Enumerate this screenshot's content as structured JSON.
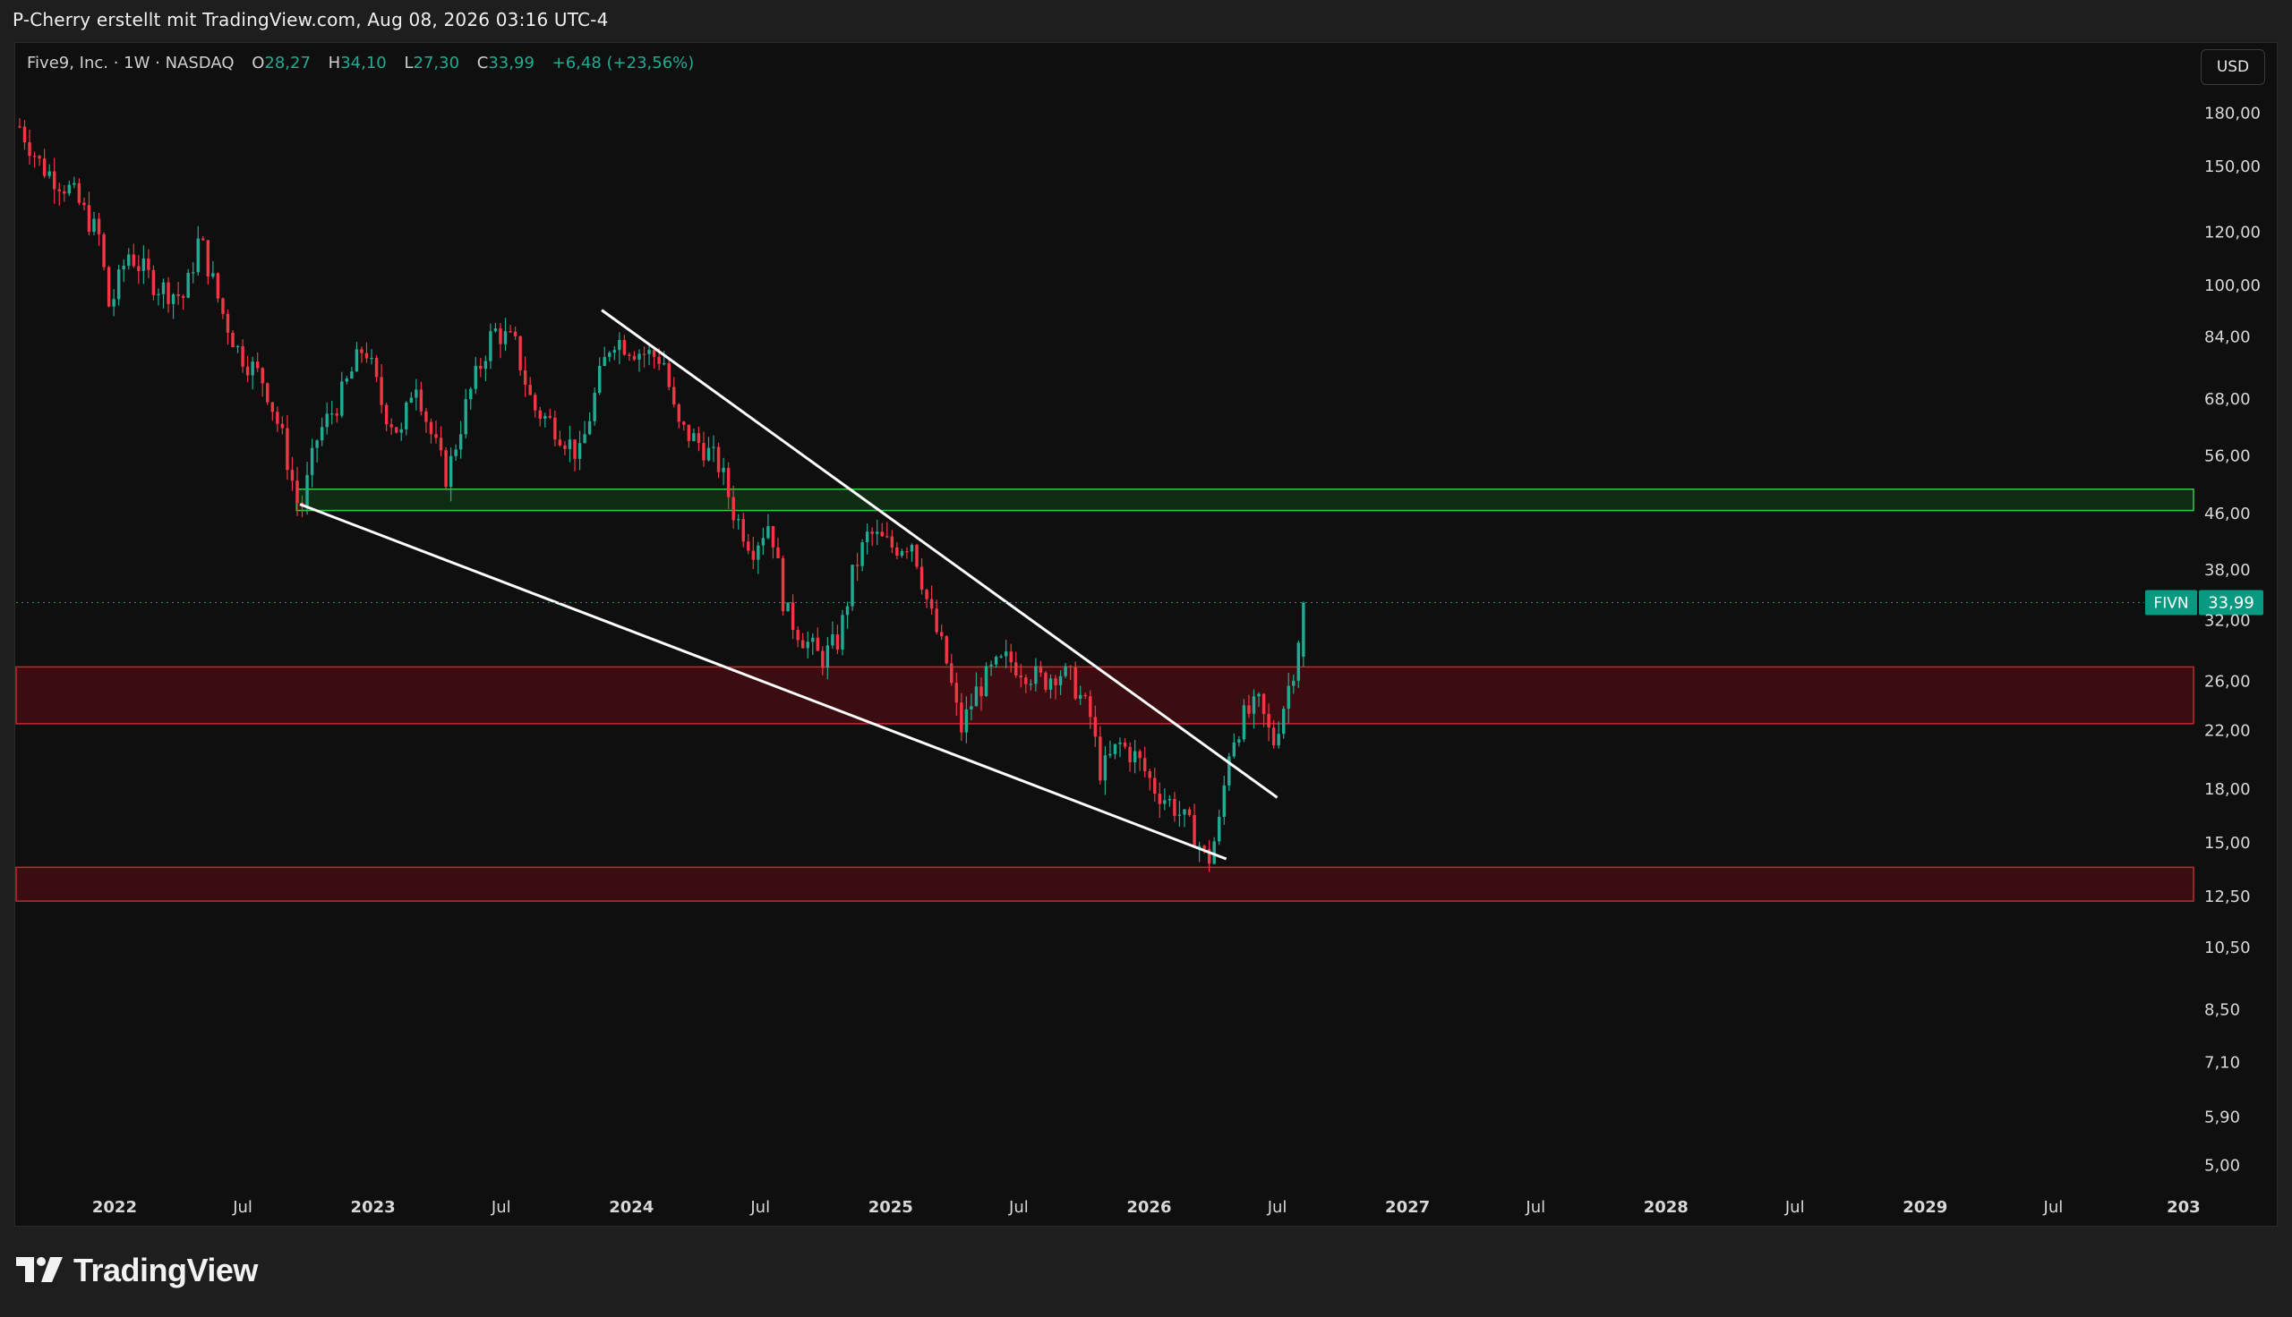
{
  "header": {
    "author_line": "P-Cherry erstellt mit TradingView.com, Aug 08, 2026 03:16 UTC-4"
  },
  "legend": {
    "symbol_line": "Five9, Inc. · 1W · NASDAQ",
    "o_label": "O",
    "o_value": "28,27",
    "h_label": "H",
    "h_value": "34,10",
    "l_label": "L",
    "l_value": "27,30",
    "c_label": "C",
    "c_value": "33,99",
    "change": "+6,48 (+23,56%)"
  },
  "currency_button": "USD",
  "brand": {
    "name": "TradingView"
  },
  "colors": {
    "up": "#22ab94",
    "down": "#f23645",
    "support_zone_fill": "#3b0d10",
    "support_zone_border": "#c62833",
    "resistance_zone_fill": "#0f2d12",
    "resistance_zone_border": "#2ecc40",
    "trendline": "#ffffff",
    "price_badge": "#089981"
  },
  "chart_data": {
    "type": "candlestick",
    "timeframe": "1W",
    "y_scale": "log",
    "ylim": [
      4.6,
      195
    ],
    "xlim": [
      "2021-08-15",
      "2030-01-15"
    ],
    "y_ticks": [
      {
        "value": 180,
        "label": "180,00"
      },
      {
        "value": 150,
        "label": "150,00"
      },
      {
        "value": 120,
        "label": "120,00"
      },
      {
        "value": 100,
        "label": "100,00"
      },
      {
        "value": 84,
        "label": "84,00"
      },
      {
        "value": 68,
        "label": "68,00"
      },
      {
        "value": 56,
        "label": "56,00"
      },
      {
        "value": 46,
        "label": "46,00"
      },
      {
        "value": 38,
        "label": "38,00"
      },
      {
        "value": 32,
        "label": "32,00"
      },
      {
        "value": 26,
        "label": "26,00"
      },
      {
        "value": 22,
        "label": "22,00"
      },
      {
        "value": 18,
        "label": "18,00"
      },
      {
        "value": 15,
        "label": "15,00"
      },
      {
        "value": 12.5,
        "label": "12,50"
      },
      {
        "value": 10.5,
        "label": "10,50"
      },
      {
        "value": 8.5,
        "label": "8,50"
      },
      {
        "value": 7.1,
        "label": "7,10"
      },
      {
        "value": 5.9,
        "label": "5,90"
      },
      {
        "value": 5.0,
        "label": "5,00"
      }
    ],
    "x_ticks": [
      {
        "date": "2022-01-01",
        "label": "2022",
        "major": true
      },
      {
        "date": "2022-07-01",
        "label": "Jul",
        "major": false
      },
      {
        "date": "2023-01-01",
        "label": "2023",
        "major": true
      },
      {
        "date": "2023-07-01",
        "label": "Jul",
        "major": false
      },
      {
        "date": "2024-01-01",
        "label": "2024",
        "major": true
      },
      {
        "date": "2024-07-01",
        "label": "Jul",
        "major": false
      },
      {
        "date": "2025-01-01",
        "label": "2025",
        "major": true
      },
      {
        "date": "2025-07-01",
        "label": "Jul",
        "major": false
      },
      {
        "date": "2026-01-01",
        "label": "2026",
        "major": true
      },
      {
        "date": "2026-07-01",
        "label": "Jul",
        "major": false
      },
      {
        "date": "2027-01-01",
        "label": "2027",
        "major": true
      },
      {
        "date": "2027-07-01",
        "label": "Jul",
        "major": false
      },
      {
        "date": "2028-01-01",
        "label": "2028",
        "major": true
      },
      {
        "date": "2028-07-01",
        "label": "Jul",
        "major": false
      },
      {
        "date": "2029-01-01",
        "label": "2029",
        "major": true
      },
      {
        "date": "2029-07-01",
        "label": "Jul",
        "major": false
      },
      {
        "date": "2030-01-01",
        "label": "203",
        "major": true
      }
    ],
    "price_anchors": [
      [
        "2021-08-20",
        172
      ],
      [
        "2021-09-20",
        150
      ],
      [
        "2021-11-01",
        138
      ],
      [
        "2021-12-10",
        118
      ],
      [
        "2021-12-25",
        92
      ],
      [
        "2022-01-20",
        112
      ],
      [
        "2022-03-01",
        100
      ],
      [
        "2022-04-10",
        96
      ],
      [
        "2022-05-01",
        118
      ],
      [
        "2022-06-01",
        92
      ],
      [
        "2022-06-25",
        80
      ],
      [
        "2022-08-01",
        72
      ],
      [
        "2022-08-25",
        60
      ],
      [
        "2022-09-20",
        46
      ],
      [
        "2022-10-15",
        60
      ],
      [
        "2022-11-15",
        68
      ],
      [
        "2022-12-20",
        82
      ],
      [
        "2023-01-15",
        66
      ],
      [
        "2023-02-10",
        60
      ],
      [
        "2023-03-01",
        74
      ],
      [
        "2023-03-20",
        62
      ],
      [
        "2023-04-15",
        52
      ],
      [
        "2023-05-15",
        68
      ],
      [
        "2023-06-20",
        86
      ],
      [
        "2023-07-20",
        82
      ],
      [
        "2023-08-15",
        66
      ],
      [
        "2023-09-15",
        62
      ],
      [
        "2023-10-20",
        56
      ],
      [
        "2023-11-15",
        72
      ],
      [
        "2023-12-05",
        84
      ],
      [
        "2024-01-10",
        80
      ],
      [
        "2024-02-15",
        78
      ],
      [
        "2024-03-05",
        62
      ],
      [
        "2024-04-10",
        58
      ],
      [
        "2024-05-05",
        54
      ],
      [
        "2024-05-25",
        46
      ],
      [
        "2024-06-20",
        41
      ],
      [
        "2024-07-15",
        45
      ],
      [
        "2024-08-05",
        33
      ],
      [
        "2024-09-01",
        30
      ],
      [
        "2024-09-25",
        28
      ],
      [
        "2024-10-20",
        30
      ],
      [
        "2024-11-10",
        38
      ],
      [
        "2024-12-01",
        43
      ],
      [
        "2025-01-05",
        41
      ],
      [
        "2025-02-01",
        42
      ],
      [
        "2025-02-25",
        33
      ],
      [
        "2025-03-20",
        28
      ],
      [
        "2025-04-10",
        22
      ],
      [
        "2025-05-01",
        25
      ],
      [
        "2025-05-25",
        27
      ],
      [
        "2025-06-15",
        28
      ],
      [
        "2025-07-10",
        27
      ],
      [
        "2025-08-05",
        26
      ],
      [
        "2025-08-25",
        27
      ],
      [
        "2025-09-15",
        26
      ],
      [
        "2025-10-10",
        23
      ],
      [
        "2025-10-25",
        19
      ],
      [
        "2025-11-20",
        21
      ],
      [
        "2025-12-15",
        20
      ],
      [
        "2026-01-10",
        18
      ],
      [
        "2026-02-05",
        17
      ],
      [
        "2026-03-05",
        15.5
      ],
      [
        "2026-03-25",
        14
      ],
      [
        "2026-04-10",
        16
      ],
      [
        "2026-04-25",
        21
      ],
      [
        "2026-05-15",
        23
      ],
      [
        "2026-06-05",
        24
      ],
      [
        "2026-06-25",
        21
      ],
      [
        "2026-07-10",
        24
      ],
      [
        "2026-07-25",
        27.5
      ],
      [
        "2026-08-07",
        33.99
      ]
    ],
    "zones": [
      {
        "role": "resistance",
        "from": "2022-09-15",
        "to": "2030-01-15",
        "low": 46.5,
        "high": 50.0
      },
      {
        "role": "support",
        "from": "2021-08-15",
        "to": "2030-01-15",
        "low": 22.5,
        "high": 27.3
      },
      {
        "role": "support",
        "from": "2021-08-15",
        "to": "2030-01-15",
        "low": 12.3,
        "high": 13.8
      }
    ],
    "trendlines": [
      {
        "from": [
          "2022-09-20",
          47.5
        ],
        "to": [
          "2026-04-20",
          14.2
        ]
      },
      {
        "from": [
          "2023-11-20",
          92
        ],
        "to": [
          "2026-07-01",
          17.5
        ]
      }
    ],
    "last_price": {
      "symbol": "FIVN",
      "label": "33,99",
      "value": 33.99
    }
  }
}
